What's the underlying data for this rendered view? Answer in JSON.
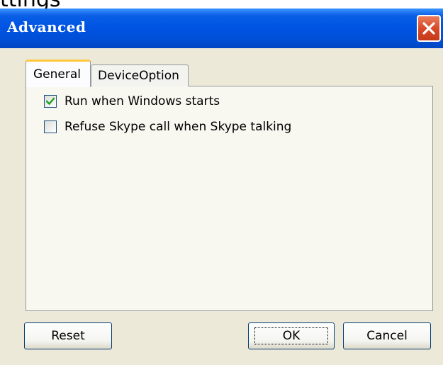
{
  "window": {
    "title": "Advanced",
    "close_icon": "close-icon"
  },
  "background_fragment": "ttings",
  "tabs": [
    {
      "label": "General",
      "selected": true
    },
    {
      "label": "DeviceOption",
      "selected": false
    }
  ],
  "general": {
    "options": [
      {
        "label": "Run when Windows starts",
        "checked": true
      },
      {
        "label": "Refuse Skype call when Skype talking",
        "checked": false
      }
    ]
  },
  "buttons": {
    "reset": "Reset",
    "ok": "OK",
    "cancel": "Cancel"
  },
  "colors": {
    "titlebar": "#0054e3",
    "dialog": "#ece9d8",
    "tab_highlight": "#ffc83c",
    "close_button": "#d84a27"
  }
}
